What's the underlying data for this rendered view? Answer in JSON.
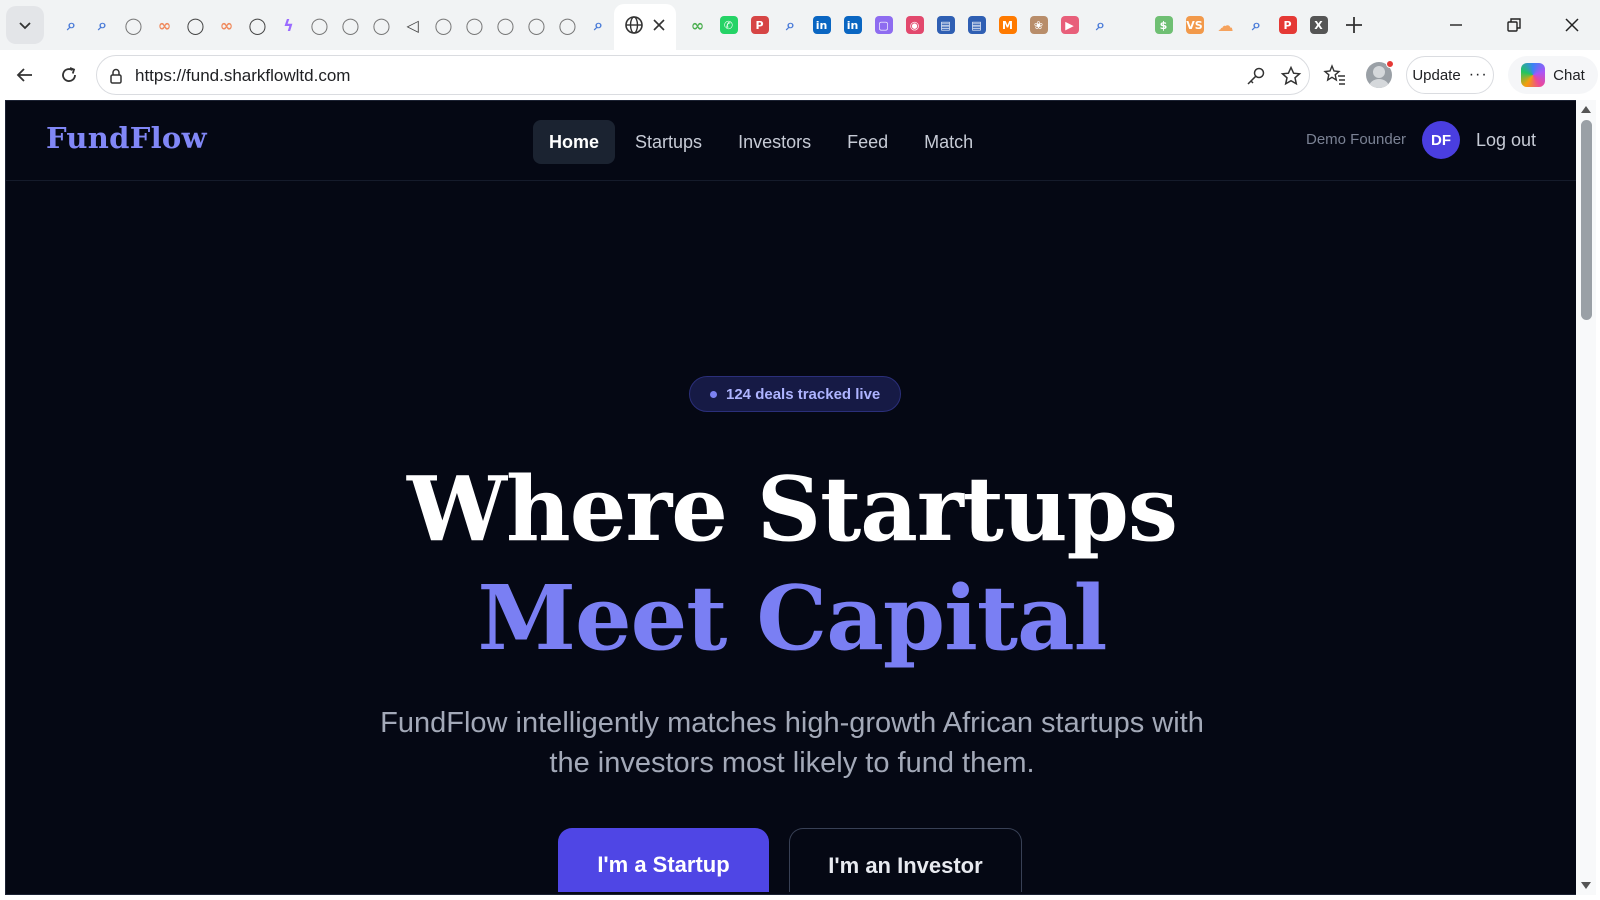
{
  "browser": {
    "url": "https://fund.sharkflowltd.com",
    "update_label": "Update",
    "chat_label": "Chat",
    "tab_icons": [
      {
        "name": "search-icon",
        "glyph": "⌕",
        "color": "#4a7bd8"
      },
      {
        "name": "search-icon",
        "glyph": "⌕",
        "color": "#4a7bd8"
      },
      {
        "name": "globe-icon",
        "glyph": "◯",
        "color": "#777777"
      },
      {
        "name": "link-icon",
        "glyph": "∞",
        "color": "#f08a5d"
      },
      {
        "name": "globe-icon",
        "glyph": "◯",
        "color": "#444444"
      },
      {
        "name": "link-icon",
        "glyph": "∞",
        "color": "#f08a5d"
      },
      {
        "name": "globe-icon",
        "glyph": "◯",
        "color": "#444444"
      },
      {
        "name": "bolt-icon",
        "glyph": "ϟ",
        "color": "#9b6bff"
      },
      {
        "name": "globe-icon",
        "glyph": "◯",
        "color": "#777777"
      },
      {
        "name": "globe-icon",
        "glyph": "◯",
        "color": "#777777"
      },
      {
        "name": "globe-icon",
        "glyph": "◯",
        "color": "#777777"
      },
      {
        "name": "speaker-icon",
        "glyph": "◁",
        "color": "#444444"
      },
      {
        "name": "globe-icon",
        "glyph": "◯",
        "color": "#777777"
      },
      {
        "name": "globe-icon",
        "glyph": "◯",
        "color": "#777777"
      },
      {
        "name": "globe-icon",
        "glyph": "◯",
        "color": "#777777"
      },
      {
        "name": "globe-icon",
        "glyph": "◯",
        "color": "#777777"
      },
      {
        "name": "globe-icon",
        "glyph": "◯",
        "color": "#777777"
      },
      {
        "name": "search-icon",
        "glyph": "⌕",
        "color": "#4a7bd8"
      }
    ],
    "tab_icons_right": [
      {
        "name": "link-icon",
        "glyph": "∞",
        "color": "#4caf50"
      },
      {
        "name": "whatsapp-icon",
        "glyph": "✆",
        "color": "#25d366"
      },
      {
        "name": "pdf-icon",
        "glyph": "P",
        "color": "#d64545"
      },
      {
        "name": "search-icon",
        "glyph": "⌕",
        "color": "#4a7bd8"
      },
      {
        "name": "linkedin-icon",
        "glyph": "in",
        "color": "#0a66c2"
      },
      {
        "name": "linkedin-icon",
        "glyph": "in",
        "color": "#0a66c2"
      },
      {
        "name": "chat-icon",
        "glyph": "▢",
        "color": "#8e6cf0"
      },
      {
        "name": "copilot-icon",
        "glyph": "◉",
        "color": "#e2486d"
      },
      {
        "name": "document-search-icon",
        "glyph": "▤",
        "color": "#2f5fb3"
      },
      {
        "name": "document-search-icon",
        "glyph": "▤",
        "color": "#2f5fb3"
      },
      {
        "name": "m-logo-icon",
        "glyph": "M",
        "color": "#ff7a00"
      },
      {
        "name": "image-icon",
        "glyph": "❀",
        "color": "#b88d6a"
      },
      {
        "name": "youtube-icon",
        "glyph": "▶",
        "color": "#e85f7a"
      },
      {
        "name": "search-icon",
        "glyph": "⌕",
        "color": "#4a7bd8"
      }
    ],
    "tab_icons_far": [
      {
        "name": "money-icon",
        "glyph": "$",
        "color": "#6fbf73"
      },
      {
        "name": "vs-icon",
        "glyph": "VS",
        "color": "#f2994a"
      },
      {
        "name": "cloud-icon",
        "glyph": "☁",
        "color": "#f5a25d"
      },
      {
        "name": "search-icon",
        "glyph": "⌕",
        "color": "#4a7bd8"
      },
      {
        "name": "p-logo-icon",
        "glyph": "P",
        "color": "#e53935"
      },
      {
        "name": "x-logo-icon",
        "glyph": "X",
        "color": "#555555"
      }
    ]
  },
  "site": {
    "logo": "FundFlow",
    "nav": [
      {
        "label": "Home",
        "active": true
      },
      {
        "label": "Startups",
        "active": false
      },
      {
        "label": "Investors",
        "active": false
      },
      {
        "label": "Feed",
        "active": false
      },
      {
        "label": "Match",
        "active": false
      }
    ],
    "user_name": "Demo Founder",
    "user_initials": "DF",
    "logout_label": "Log out"
  },
  "hero": {
    "badge": "124 deals tracked live",
    "title_line1": "Where Startups",
    "title_line2": "Meet Capital",
    "subtitle": "FundFlow intelligently matches high-growth African startups with the investors most likely to fund them.",
    "cta_primary": "I'm a Startup",
    "cta_secondary": "I'm an Investor"
  },
  "colors": {
    "page_bg": "#050814",
    "accent": "#7a7ff3",
    "primary_button": "#4f46e5"
  }
}
